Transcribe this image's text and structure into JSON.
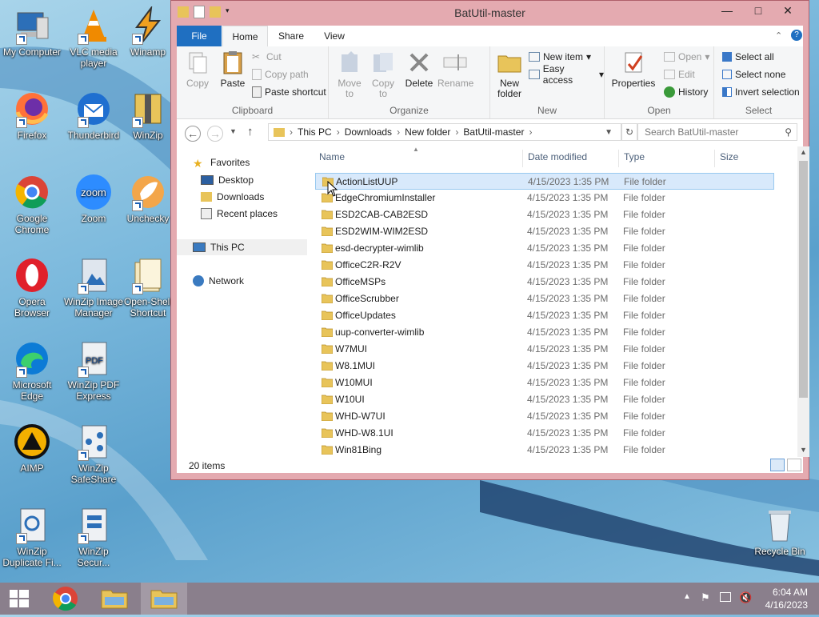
{
  "desktop": {
    "icons": [
      {
        "label": "My Computer"
      },
      {
        "label": "VLC media player"
      },
      {
        "label": "Winamp"
      },
      {
        "label": "Firefox"
      },
      {
        "label": "Thunderbird"
      },
      {
        "label": "WinZip"
      },
      {
        "label": "Google Chrome"
      },
      {
        "label": "Zoom"
      },
      {
        "label": "Unchecky"
      },
      {
        "label": "Opera Browser"
      },
      {
        "label": "WinZip Image Manager"
      },
      {
        "label": "Open-Shell Shortcut"
      },
      {
        "label": "Microsoft Edge"
      },
      {
        "label": "WinZip PDF Express"
      },
      {
        "label": "AIMP"
      },
      {
        "label": "WinZip SafeShare"
      },
      {
        "label": "WinZip Duplicate Fi..."
      },
      {
        "label": "WinZip Secur..."
      },
      {
        "label": "Recycle Bin"
      }
    ]
  },
  "window": {
    "title": "BatUtil-master",
    "tabs": {
      "file": "File",
      "home": "Home",
      "share": "Share",
      "view": "View"
    },
    "ribbon": {
      "clipboard": {
        "title": "Clipboard",
        "copy": "Copy",
        "paste": "Paste",
        "cut": "Cut",
        "copy_path": "Copy path",
        "paste_shortcut": "Paste shortcut"
      },
      "organize": {
        "title": "Organize",
        "move_to": "Move to",
        "copy_to": "Copy to",
        "delete": "Delete",
        "rename": "Rename"
      },
      "new": {
        "title": "New",
        "new_folder": "New folder",
        "new_item": "New item",
        "easy_access": "Easy access"
      },
      "open": {
        "title": "Open",
        "properties": "Properties",
        "open": "Open",
        "edit": "Edit",
        "history": "History"
      },
      "select": {
        "title": "Select",
        "select_all": "Select all",
        "select_none": "Select none",
        "invert_selection": "Invert selection"
      }
    },
    "address": {
      "crumbs": [
        "This PC",
        "Downloads",
        "New folder",
        "BatUtil-master"
      ],
      "search_placeholder": "Search BatUtil-master"
    },
    "nav": {
      "favorites": "Favorites",
      "desktop": "Desktop",
      "downloads": "Downloads",
      "recent": "Recent places",
      "this_pc": "This PC",
      "network": "Network"
    },
    "columns": {
      "name": "Name",
      "date": "Date modified",
      "type": "Type",
      "size": "Size"
    },
    "files": [
      {
        "name": "ActionListUUP",
        "date": "4/15/2023 1:35 PM",
        "type": "File folder"
      },
      {
        "name": "EdgeChromiumInstaller",
        "date": "4/15/2023 1:35 PM",
        "type": "File folder"
      },
      {
        "name": "ESD2CAB-CAB2ESD",
        "date": "4/15/2023 1:35 PM",
        "type": "File folder"
      },
      {
        "name": "ESD2WIM-WIM2ESD",
        "date": "4/15/2023 1:35 PM",
        "type": "File folder"
      },
      {
        "name": "esd-decrypter-wimlib",
        "date": "4/15/2023 1:35 PM",
        "type": "File folder"
      },
      {
        "name": "OfficeC2R-R2V",
        "date": "4/15/2023 1:35 PM",
        "type": "File folder"
      },
      {
        "name": "OfficeMSPs",
        "date": "4/15/2023 1:35 PM",
        "type": "File folder"
      },
      {
        "name": "OfficeScrubber",
        "date": "4/15/2023 1:35 PM",
        "type": "File folder"
      },
      {
        "name": "OfficeUpdates",
        "date": "4/15/2023 1:35 PM",
        "type": "File folder"
      },
      {
        "name": "uup-converter-wimlib",
        "date": "4/15/2023 1:35 PM",
        "type": "File folder"
      },
      {
        "name": "W7MUI",
        "date": "4/15/2023 1:35 PM",
        "type": "File folder"
      },
      {
        "name": "W8.1MUI",
        "date": "4/15/2023 1:35 PM",
        "type": "File folder"
      },
      {
        "name": "W10MUI",
        "date": "4/15/2023 1:35 PM",
        "type": "File folder"
      },
      {
        "name": "W10UI",
        "date": "4/15/2023 1:35 PM",
        "type": "File folder"
      },
      {
        "name": "WHD-W7UI",
        "date": "4/15/2023 1:35 PM",
        "type": "File folder"
      },
      {
        "name": "WHD-W8.1UI",
        "date": "4/15/2023 1:35 PM",
        "type": "File folder"
      },
      {
        "name": "Win81Bing",
        "date": "4/15/2023 1:35 PM",
        "type": "File folder"
      }
    ],
    "status": "20 items"
  },
  "taskbar": {
    "time": "6:04 AM",
    "date": "4/16/2023"
  },
  "colors": {
    "accent": "#1f6fc1",
    "titlebar": "#e4aab0",
    "taskbar": "#8a7f8c",
    "folder": "#e8c45a"
  }
}
